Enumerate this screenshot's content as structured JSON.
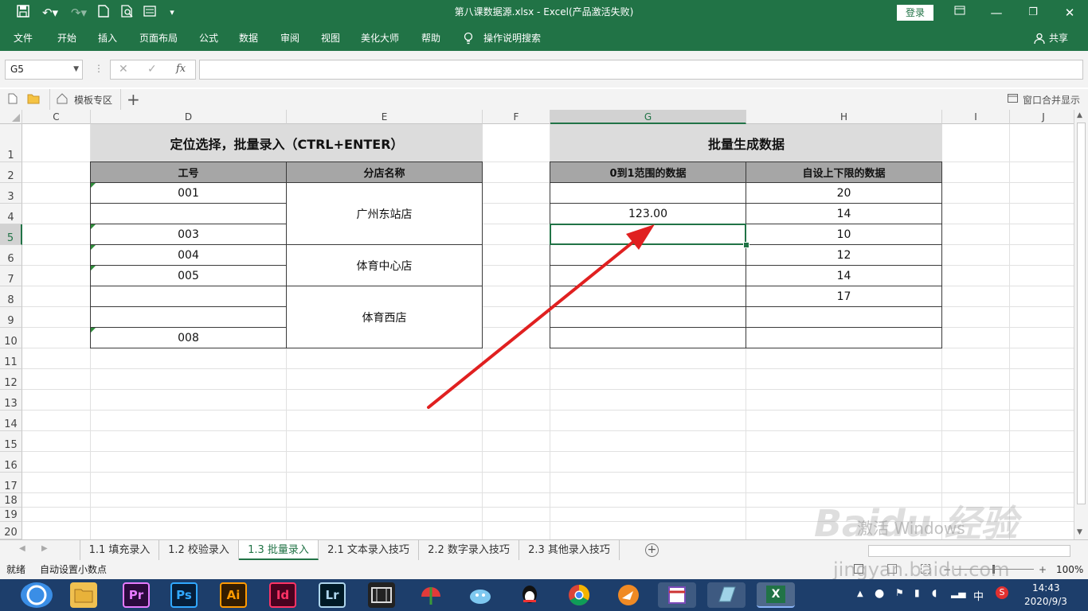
{
  "window": {
    "title": "第八课数据源.xlsx  -  Excel(产品激活失败)",
    "login_label": "登录",
    "share_label": "共享"
  },
  "ribbon_tabs": [
    "文件",
    "开始",
    "插入",
    "页面布局",
    "公式",
    "数据",
    "审阅",
    "视图",
    "美化大师",
    "帮助"
  ],
  "search_hint": "操作说明搜索",
  "formula_bar": {
    "name_box": "G5",
    "fx_label": "fx",
    "formula": ""
  },
  "doc_tabs": {
    "template_label": "模板专区",
    "merge_label": "窗口合并显示"
  },
  "columns": [
    "C",
    "D",
    "E",
    "F",
    "G",
    "H",
    "I",
    "J"
  ],
  "rows": [
    "1",
    "2",
    "3",
    "4",
    "5",
    "6",
    "7",
    "8",
    "9",
    "10",
    "11",
    "12",
    "13",
    "14",
    "15",
    "16",
    "17",
    "18",
    "19",
    "20"
  ],
  "table_left": {
    "title": "定位选择，批量录入（CTRL+ENTER）",
    "header_d": "工号",
    "header_e": "分店名称",
    "ids": [
      "001",
      "",
      "003",
      "004",
      "005",
      "",
      "",
      "008"
    ],
    "stores": [
      "广州东站店",
      "体育中心店",
      "体育西店"
    ]
  },
  "table_right": {
    "title": "批量生成数据",
    "header_g": "0到1范围的数据",
    "header_h": "自设上下限的数据",
    "g_values": [
      "",
      "123.00",
      "",
      "",
      "",
      "",
      "",
      ""
    ],
    "h_values": [
      "20",
      "14",
      "10",
      "12",
      "14",
      "17",
      "",
      ""
    ]
  },
  "sheet_tabs": [
    "1.1 填充录入",
    "1.2 校验录入",
    "1.3 批量录入",
    "2.1 文本录入技巧",
    "2.2 数字录入技巧",
    "2.3 其他录入技巧"
  ],
  "active_sheet": "1.3 批量录入",
  "status": {
    "ready": "就绪",
    "auto_decimal": "自动设置小数点",
    "zoom": "100%"
  },
  "watermark": {
    "activate": "激活 Windows",
    "site": "jingyan.baidu.com"
  },
  "taskbar": {
    "apps": [
      "Pr",
      "Ps",
      "Ai",
      "Id",
      "Lr"
    ],
    "excel": "X",
    "ime": "中",
    "time": "14:43",
    "date": "2020/9/3"
  },
  "colors": {
    "excel_green": "#217346",
    "taskbar": "#1d3e6b",
    "arrow": "#e02020"
  }
}
